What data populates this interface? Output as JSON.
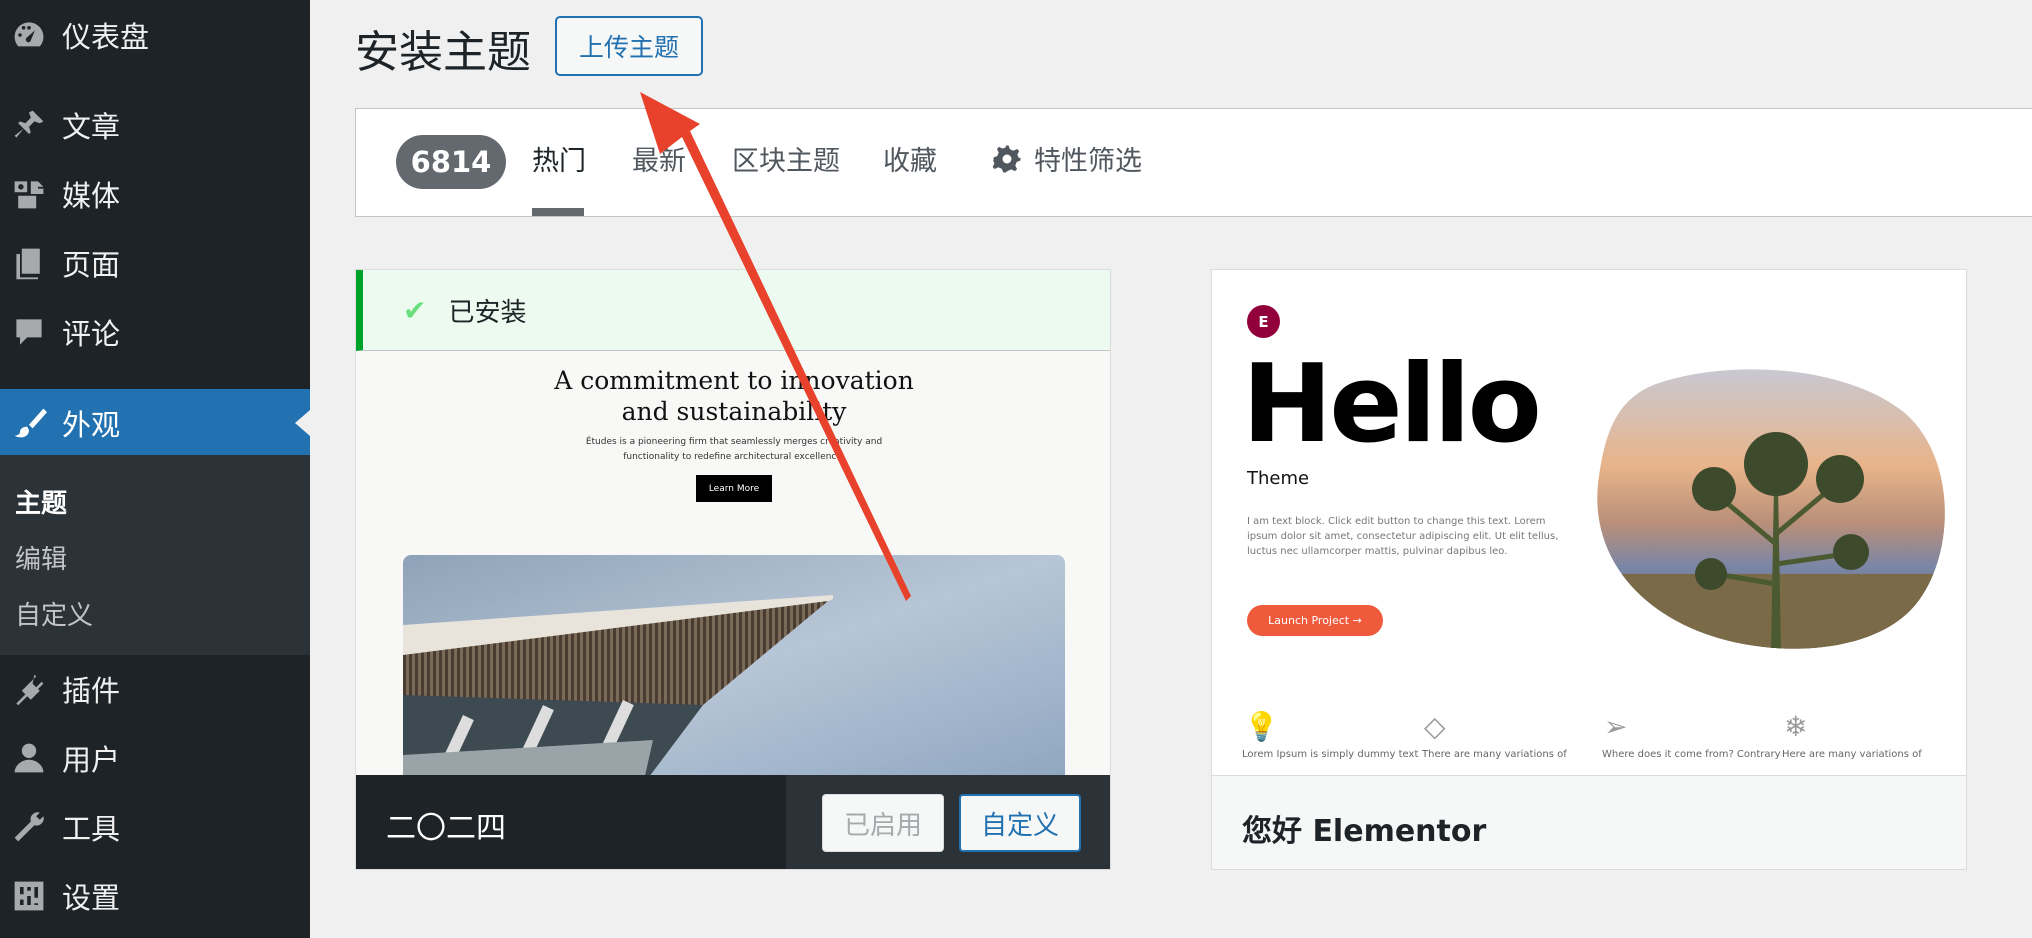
{
  "sidebar": {
    "items": [
      {
        "label": "仪表盘",
        "icon": "dashboard-icon"
      },
      {
        "label": "文章",
        "icon": "pushpin-icon"
      },
      {
        "label": "媒体",
        "icon": "media-icon"
      },
      {
        "label": "页面",
        "icon": "page-icon"
      },
      {
        "label": "评论",
        "icon": "comment-icon"
      },
      {
        "label": "外观",
        "icon": "paintbrush-icon",
        "active": true
      },
      {
        "label": "插件",
        "icon": "plugin-icon"
      },
      {
        "label": "用户",
        "icon": "user-icon"
      },
      {
        "label": "工具",
        "icon": "wrench-icon"
      },
      {
        "label": "设置",
        "icon": "settings-sliders-icon"
      }
    ],
    "submenu": [
      {
        "label": "主题",
        "current": true
      },
      {
        "label": "编辑"
      },
      {
        "label": "自定义"
      }
    ]
  },
  "header": {
    "title": "安装主题",
    "upload_label": "上传主题"
  },
  "filters": {
    "count": "6814",
    "tabs": [
      "热门",
      "最新",
      "区块主题",
      "收藏"
    ],
    "feature_filter": "特性筛选"
  },
  "themes": [
    {
      "name": "二〇二四",
      "installed_notice": "已安装",
      "activated_label": "已启用",
      "customize_label": "自定义",
      "preview": {
        "headline_line1": "A commitment to innovation",
        "headline_line2": "and sustainability",
        "description": "Études is a pioneering firm that seamlessly merges creativity and functionality to redefine architectural excellence.",
        "button": "Learn More"
      }
    },
    {
      "name": "您好 Elementor",
      "preview": {
        "logo": "E",
        "hello": "Hello",
        "subtitle": "Theme",
        "paragraph": "I am text block. Click edit button to change this text. Lorem ipsum dolor sit amet, consectetur adipiscing elit. Ut elit tellus, luctus nec ullamcorper mattis, pulvinar dapibus leo.",
        "button": "Launch Project  →",
        "features": [
          {
            "icon": "lightbulb-icon",
            "text": "Lorem Ipsum is simply dummy text"
          },
          {
            "icon": "diamond-icon",
            "text": "There are many variations of"
          },
          {
            "icon": "paper-plane-icon",
            "text": "Where does it come from? Contrary"
          },
          {
            "icon": "snowflake-icon",
            "text": "Here are many variations of"
          }
        ]
      }
    }
  ],
  "colors": {
    "sidebar_bg": "#1d2327",
    "active_blue": "#2271b1",
    "installed_green": "#00a32a",
    "annotation_red": "#e8412c"
  }
}
